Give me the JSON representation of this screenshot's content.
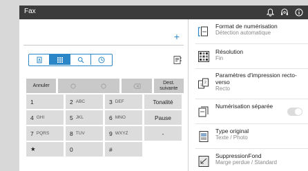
{
  "app": {
    "title": "Fax"
  },
  "titlebar_icons": [
    "bell-icon",
    "headset-icon",
    "info-icon"
  ],
  "address": {
    "add_symbol": "+"
  },
  "tabs": [
    {
      "icon": "address-book-icon",
      "active": false
    },
    {
      "icon": "keypad-icon",
      "active": true
    },
    {
      "icon": "search-icon",
      "active": false
    },
    {
      "icon": "history-clock-icon",
      "active": false
    }
  ],
  "keypad": {
    "cancel": "Annuler",
    "next_dest_line1": "Dest.",
    "next_dest_line2": "suivante",
    "keys": [
      {
        "digit": "1",
        "letters": ""
      },
      {
        "digit": "2",
        "letters": "ABC"
      },
      {
        "digit": "3",
        "letters": "DEF"
      },
      {
        "digit": "4",
        "letters": "GHI"
      },
      {
        "digit": "5",
        "letters": "JKL"
      },
      {
        "digit": "6",
        "letters": "MNO"
      },
      {
        "digit": "7",
        "letters": "PQRS"
      },
      {
        "digit": "8",
        "letters": "TUV"
      },
      {
        "digit": "9",
        "letters": "WXYZ"
      },
      {
        "digit": "★",
        "letters": ""
      },
      {
        "digit": "0",
        "letters": ""
      },
      {
        "digit": "#",
        "letters": ""
      }
    ],
    "tone": "Tonalité",
    "pause": "Pause",
    "dash": "-"
  },
  "settings": [
    {
      "icon": "scan-format-icon",
      "title": "Format de numérisation",
      "value": "Détection automatique"
    },
    {
      "icon": "resolution-icon",
      "title": "Résolution",
      "value": "Fin"
    },
    {
      "icon": "duplex-icon",
      "title": "Paramètres d'impression recto-verso",
      "value": "Recto"
    },
    {
      "icon": "separate-scan-icon",
      "title": "Numérisation séparée",
      "value": "",
      "toggle": false
    },
    {
      "icon": "original-type-icon",
      "title": "Type original",
      "value": "Texte / Photo"
    },
    {
      "icon": "background-removal-icon",
      "title": "SuppressionFond",
      "value": "Marge perdue / Standard"
    }
  ],
  "colors": {
    "accent": "#2a86c7",
    "titlebar": "#3b3b3b",
    "key_bg": "#dcdcdc"
  }
}
